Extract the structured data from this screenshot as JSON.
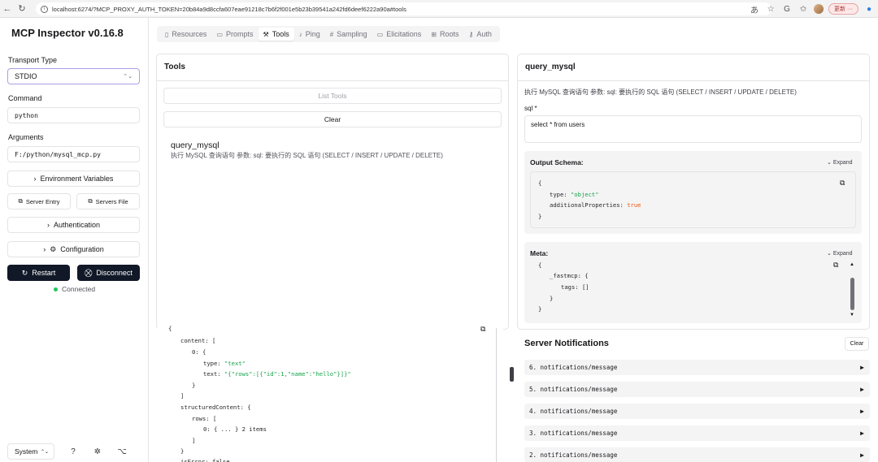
{
  "browser": {
    "url": "localhost:6274/?MCP_PROXY_AUTH_TOKEN=20b84a9d8ccfa607eae91218c7b6f2f001e5b23b39541a242fd6deef6222a90a#tools",
    "update_label": "更新"
  },
  "sidebar": {
    "title": "MCP Inspector v0.16.8",
    "transport_label": "Transport Type",
    "transport_value": "STDIO",
    "command_label": "Command",
    "command_value": "python",
    "arguments_label": "Arguments",
    "arguments_value": "F:/python/mysql_mcp.py",
    "env_vars": "Environment Variables",
    "server_entry": "Server Entry",
    "servers_file": "Servers File",
    "authentication": "Authentication",
    "configuration": "Configuration",
    "restart": "Restart",
    "disconnect": "Disconnect",
    "status": "Connected",
    "status_color": "#22c55e",
    "theme": "System"
  },
  "tabs": [
    {
      "label": "Resources",
      "icon": "file-icon"
    },
    {
      "label": "Prompts",
      "icon": "message-icon"
    },
    {
      "label": "Tools",
      "icon": "hammer-icon"
    },
    {
      "label": "Ping",
      "icon": "bell-icon"
    },
    {
      "label": "Sampling",
      "icon": "hash-icon"
    },
    {
      "label": "Elicitations",
      "icon": "message-icon"
    },
    {
      "label": "Roots",
      "icon": "network-icon"
    },
    {
      "label": "Auth",
      "icon": "key-icon"
    }
  ],
  "tools_panel": {
    "title": "Tools",
    "list_tools": "List Tools",
    "clear": "Clear",
    "tool_name": "query_mysql",
    "tool_desc": "执行 MySQL 查询语句 参数: sql: 要执行的 SQL 语句 (SELECT / INSERT / UPDATE / DELETE)"
  },
  "tool_detail": {
    "title": "query_mysql",
    "desc": "执行 MySQL 查询语句 参数: sql: 要执行的 SQL 语句 (SELECT / INSERT / UPDATE / DELETE)",
    "sql_label": "sql *",
    "sql_value": "select * from users",
    "output_schema_title": "Output Schema:",
    "meta_title": "Meta:",
    "expand": "Expand",
    "schema": {
      "open": "{",
      "type_key": "type:",
      "type_val": "\"object\"",
      "ap_key": "additionalProperties:",
      "ap_val": "true",
      "close": "}"
    },
    "meta": {
      "open": "{",
      "fastmcp": "_fastmcp: {",
      "tags": "tags: []",
      "inner_close": "}",
      "close": "}"
    }
  },
  "result": {
    "open": "{",
    "content": "content: [",
    "idx0": "0: {",
    "type_key": "type:",
    "type_val": "\"text\"",
    "text_key": "text:",
    "text_val": "\"{\"rows\":[{\"id\":1,\"name\":\"hello\"}]}\"",
    "close_obj": "}",
    "close_arr": "]",
    "structured": "structuredContent: {",
    "rows": "rows: [",
    "row0": "0: { ... } 2 items",
    "close_arr2": "]",
    "close_obj2": "}",
    "is_error": "isError: false"
  },
  "notifications": {
    "title": "Server Notifications",
    "clear": "Clear",
    "items": [
      "6. notifications/message",
      "5. notifications/message",
      "4. notifications/message",
      "3. notifications/message",
      "2. notifications/message"
    ]
  }
}
